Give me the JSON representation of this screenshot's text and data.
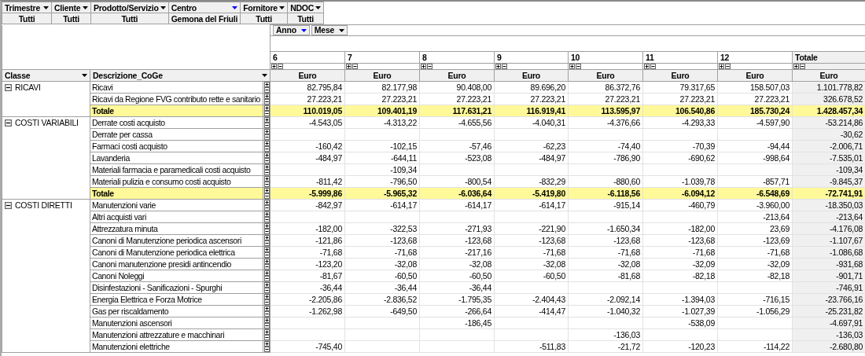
{
  "filters": [
    {
      "label": "Trimestre",
      "value": "Tutti",
      "filtered": false
    },
    {
      "label": "Cliente",
      "value": "Tutti",
      "filtered": false
    },
    {
      "label": "Prodotto/Servizio",
      "value": "Tutti",
      "filtered": false
    },
    {
      "label": "Centro",
      "value": "Gemona del Friuli",
      "filtered": true
    },
    {
      "label": "Fornitore",
      "value": "Tutti",
      "filtered": false
    },
    {
      "label": "NDOC",
      "value": "Tutti",
      "filtered": false
    }
  ],
  "column_fields": [
    {
      "label": "Anno",
      "filtered": true
    },
    {
      "label": "Mese",
      "filtered": false
    }
  ],
  "row_fields": [
    "Classe",
    "Descrizione_CoGe"
  ],
  "columns": [
    {
      "label": "6",
      "unit": "Euro",
      "kind": "month"
    },
    {
      "label": "7",
      "unit": "Euro",
      "kind": "month"
    },
    {
      "label": "8",
      "unit": "Euro",
      "kind": "month"
    },
    {
      "label": "9",
      "unit": "Euro",
      "kind": "month"
    },
    {
      "label": "10",
      "unit": "Euro",
      "kind": "month"
    },
    {
      "label": "11",
      "unit": "Euro",
      "kind": "month"
    },
    {
      "label": "12",
      "unit": "Euro",
      "kind": "month"
    },
    {
      "label": "Totale",
      "unit": "Euro",
      "kind": "total"
    }
  ],
  "classes": [
    {
      "name": "RICAVI",
      "expanded": true,
      "rows": [
        {
          "kind": "item",
          "description": "Ricavi",
          "cells": [
            {
              "text": "82.795,84"
            },
            {
              "text": "82.177,98"
            },
            {
              "text": "90.408,00"
            },
            {
              "text": "89.696,20"
            },
            {
              "text": "86.372,76"
            },
            {
              "text": "79.317,65"
            },
            {
              "text": "158.507,03"
            },
            {
              "text": "1.101.778,82"
            }
          ]
        },
        {
          "kind": "item",
          "description": "Ricavi da Regione FVG contributo rette e sanitario",
          "cells": [
            {
              "text": "27.223,21"
            },
            {
              "text": "27.223,21"
            },
            {
              "text": "27.223,21"
            },
            {
              "text": "27.223,21"
            },
            {
              "text": "27.223,21"
            },
            {
              "text": "27.223,21"
            },
            {
              "text": "27.223,21"
            },
            {
              "text": "326.678,52"
            }
          ]
        },
        {
          "kind": "total",
          "description": "Totale",
          "cells": [
            {
              "text": "110.019,05"
            },
            {
              "text": "109.401,19"
            },
            {
              "text": "117.631,21"
            },
            {
              "text": "116.919,41"
            },
            {
              "text": "113.595,97"
            },
            {
              "text": "106.540,86"
            },
            {
              "text": "185.730,24"
            },
            {
              "text": "1.428.457,34"
            }
          ]
        }
      ]
    },
    {
      "name": "COSTI VARIABILI",
      "expanded": true,
      "rows": [
        {
          "kind": "item",
          "description": "Derrate costi acquisto",
          "cells": [
            {
              "text": "-4.543,05"
            },
            {
              "text": "-4.313,22"
            },
            {
              "text": "-4.655,56"
            },
            {
              "text": "-4.040,31"
            },
            {
              "text": "-4.376,66"
            },
            {
              "text": "-4.293,33"
            },
            {
              "text": "-4.597,90"
            },
            {
              "text": "-53.214,86"
            }
          ]
        },
        {
          "kind": "item",
          "description": "Derrate per cassa",
          "cells": [
            {},
            {},
            {},
            {},
            {},
            {},
            {},
            {
              "text": "-30,62"
            }
          ]
        },
        {
          "kind": "item",
          "description": "Farmaci costi acquisto",
          "cells": [
            {
              "text": "-160,42"
            },
            {
              "text": "-102,15"
            },
            {
              "text": "-57,46"
            },
            {
              "text": "-62,23"
            },
            {
              "text": "-74,40"
            },
            {
              "text": "-70,39"
            },
            {
              "text": "-94,44"
            },
            {
              "text": "-2.006,71"
            }
          ]
        },
        {
          "kind": "item",
          "description": "Lavanderia",
          "cells": [
            {
              "text": "-484,97"
            },
            {
              "text": "-644,11"
            },
            {
              "text": "-523,08"
            },
            {
              "text": "-484,97"
            },
            {
              "text": "-786,90"
            },
            {
              "text": "-690,62"
            },
            {
              "text": "-998,64"
            },
            {
              "text": "-7.535,01"
            }
          ]
        },
        {
          "kind": "item",
          "description": "Materiali farmacia e paramedicali costi acquisto",
          "cells": [
            {},
            {
              "text": "-109,34"
            },
            {},
            {},
            {},
            {},
            {},
            {
              "text": "-109,34"
            }
          ]
        },
        {
          "kind": "item",
          "description": "Materiali pulizia e consumo costi acquisto",
          "cells": [
            {
              "text": "-811,42"
            },
            {
              "text": "-796,50"
            },
            {
              "text": "-800,54"
            },
            {
              "text": "-832,29"
            },
            {
              "text": "-880,60"
            },
            {
              "text": "-1.039,78"
            },
            {
              "text": "-857,71"
            },
            {
              "text": "-9.845,37"
            }
          ]
        },
        {
          "kind": "total",
          "description": "Totale",
          "cells": [
            {
              "text": "-5.999,86"
            },
            {
              "text": "-5.965,32"
            },
            {
              "text": "-6.036,64"
            },
            {
              "text": "-5.419,80"
            },
            {
              "text": "-6.118,56"
            },
            {
              "text": "-6.094,12"
            },
            {
              "text": "-6.548,69"
            },
            {
              "text": "-72.741,91"
            }
          ]
        }
      ]
    },
    {
      "name": "COSTI DIRETTI",
      "expanded": true,
      "rows": [
        {
          "kind": "item",
          "description": "Manutenzioni varie",
          "cells": [
            {
              "text": "-842,97"
            },
            {
              "text": "-614,17"
            },
            {
              "text": "-614,17"
            },
            {
              "text": "-614,17"
            },
            {
              "text": "-915,14"
            },
            {
              "text": "-460,79"
            },
            {
              "text": "-3.960,00"
            },
            {
              "text": "-18.350,03"
            }
          ]
        },
        {
          "kind": "item",
          "description": "Altri acquisti vari",
          "cells": [
            {},
            {},
            {},
            {},
            {},
            {},
            {
              "text": "-213,64"
            },
            {
              "text": "-213,64"
            }
          ]
        },
        {
          "kind": "item",
          "description": "Attrezzatura minuta",
          "cells": [
            {
              "text": "-182,00"
            },
            {
              "text": "-322,53"
            },
            {
              "text": "-271,93"
            },
            {
              "text": "-221,90"
            },
            {
              "text": "-1.650,34"
            },
            {
              "text": "-182,00"
            },
            {
              "text": "23,69"
            },
            {
              "text": "-4.176,08"
            }
          ]
        },
        {
          "kind": "item",
          "description": "Canoni di Manutenzione periodica ascensori",
          "cells": [
            {
              "text": "-121,86"
            },
            {
              "text": "-123,68"
            },
            {
              "text": "-123,68"
            },
            {
              "text": "-123,68"
            },
            {
              "text": "-123,68"
            },
            {
              "text": "-123,68"
            },
            {
              "text": "-123,69"
            },
            {
              "text": "-1.107,67"
            }
          ]
        },
        {
          "kind": "item",
          "description": "Canoni di Manutenzione periodica elettrica",
          "cells": [
            {
              "text": "-71,68"
            },
            {
              "text": "-71,68"
            },
            {
              "text": "-217,16"
            },
            {
              "text": "-71,68"
            },
            {
              "text": "-71,68"
            },
            {
              "text": "-71,68"
            },
            {
              "text": "-71,68"
            },
            {
              "text": "-1.086,68"
            }
          ]
        },
        {
          "kind": "item",
          "description": "Canoni manutenzione presidi antincendio",
          "cells": [
            {
              "text": "-123,20"
            },
            {
              "text": "-32,08"
            },
            {
              "text": "-32,08"
            },
            {
              "text": "-32,08"
            },
            {
              "text": "-32,08"
            },
            {
              "text": "-32,09"
            },
            {
              "text": "-32,09"
            },
            {
              "text": "-931,68"
            }
          ]
        },
        {
          "kind": "item",
          "description": "Canoni Noleggi",
          "cells": [
            {
              "text": "-81,67"
            },
            {
              "text": "-60,50"
            },
            {
              "text": "-60,50"
            },
            {
              "text": "-60,50"
            },
            {
              "text": "-81,68"
            },
            {
              "text": "-82,18"
            },
            {
              "text": "-82,18"
            },
            {
              "text": "-901,71"
            }
          ]
        },
        {
          "kind": "item",
          "description": "Disinfestazioni - Sanificazioni - Spurghi",
          "cells": [
            {
              "text": "-36,44"
            },
            {
              "text": "-36,44"
            },
            {
              "text": "-36,44"
            },
            {},
            {},
            {},
            {},
            {
              "text": "-746,91"
            }
          ]
        },
        {
          "kind": "item",
          "description": "Energia Elettrica e Forza Motrice",
          "cells": [
            {
              "text": "-2.205,86"
            },
            {
              "text": "-2.836,52"
            },
            {
              "text": "-1.795,35"
            },
            {
              "text": "-2.404,43"
            },
            {
              "text": "-2.092,14"
            },
            {
              "text": "-1.394,03"
            },
            {
              "text": "-716,15"
            },
            {
              "text": "-23.766,16"
            }
          ]
        },
        {
          "kind": "item",
          "description": "Gas per riscaldamento",
          "cells": [
            {
              "text": "-1.262,98"
            },
            {
              "text": "-649,50"
            },
            {
              "text": "-266,64"
            },
            {
              "text": "-414,47"
            },
            {
              "text": "-1.040,32"
            },
            {
              "text": "-1.027,39"
            },
            {
              "text": "-1.056,29"
            },
            {
              "text": "-25.231,82"
            }
          ]
        },
        {
          "kind": "item",
          "description": "Manutenzioni ascensori",
          "cells": [
            {},
            {},
            {
              "text": "-186,45"
            },
            {},
            {},
            {
              "text": "-538,09"
            },
            {},
            {
              "text": "-4.697,91"
            }
          ]
        },
        {
          "kind": "item",
          "description": "Manutenzioni attrezzature e macchinari",
          "cells": [
            {},
            {},
            {},
            {},
            {
              "text": "-136,03"
            },
            {},
            {},
            {
              "text": "-136,03"
            }
          ]
        },
        {
          "kind": "item",
          "description": "Manutenzioni elettriche",
          "cells": [
            {
              "text": "-745,40"
            },
            {},
            {},
            {
              "text": "-511,83"
            },
            {
              "text": "-21,72"
            },
            {
              "text": "-120,23"
            },
            {
              "text": "-114,22"
            },
            {
              "text": "-2.680,80"
            }
          ]
        }
      ]
    }
  ]
}
